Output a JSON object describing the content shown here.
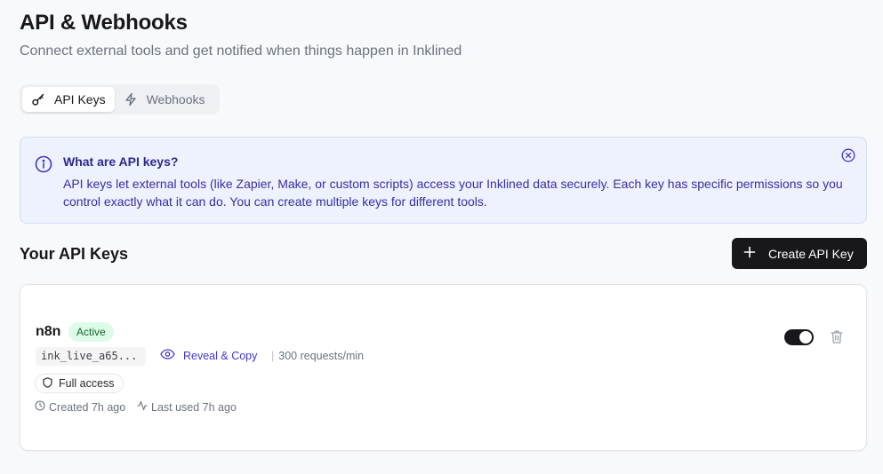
{
  "header": {
    "title": "API & Webhooks",
    "subtitle": "Connect external tools and get notified when things happen in Inklined"
  },
  "tabs": [
    {
      "label": "API Keys",
      "icon": "key-icon",
      "active": true
    },
    {
      "label": "Webhooks",
      "icon": "lightning-icon",
      "active": false
    }
  ],
  "info": {
    "title": "What are API keys?",
    "body": "API keys let external tools (like Zapier, Make, or custom scripts) access your Inklined data securely. Each key has specific permissions so you control exactly what it can do. You can create multiple keys for different tools."
  },
  "keys_section": {
    "title": "Your API Keys",
    "create_label": "Create API Key"
  },
  "api_keys": [
    {
      "name": "n8n",
      "status": "Active",
      "prefix": "ink_live_a65...",
      "reveal_label": "Reveal & Copy",
      "rate_limit": "300 requests/min",
      "scope": "Full access",
      "created": "Created 7h ago",
      "last_used": "Last used 7h ago",
      "enabled": true
    }
  ],
  "colors": {
    "accent": "#4338ca",
    "info_bg": "#eef1fe",
    "active_badge_bg": "#dcfce7",
    "active_badge_text": "#166534",
    "primary_button": "#18181b"
  }
}
